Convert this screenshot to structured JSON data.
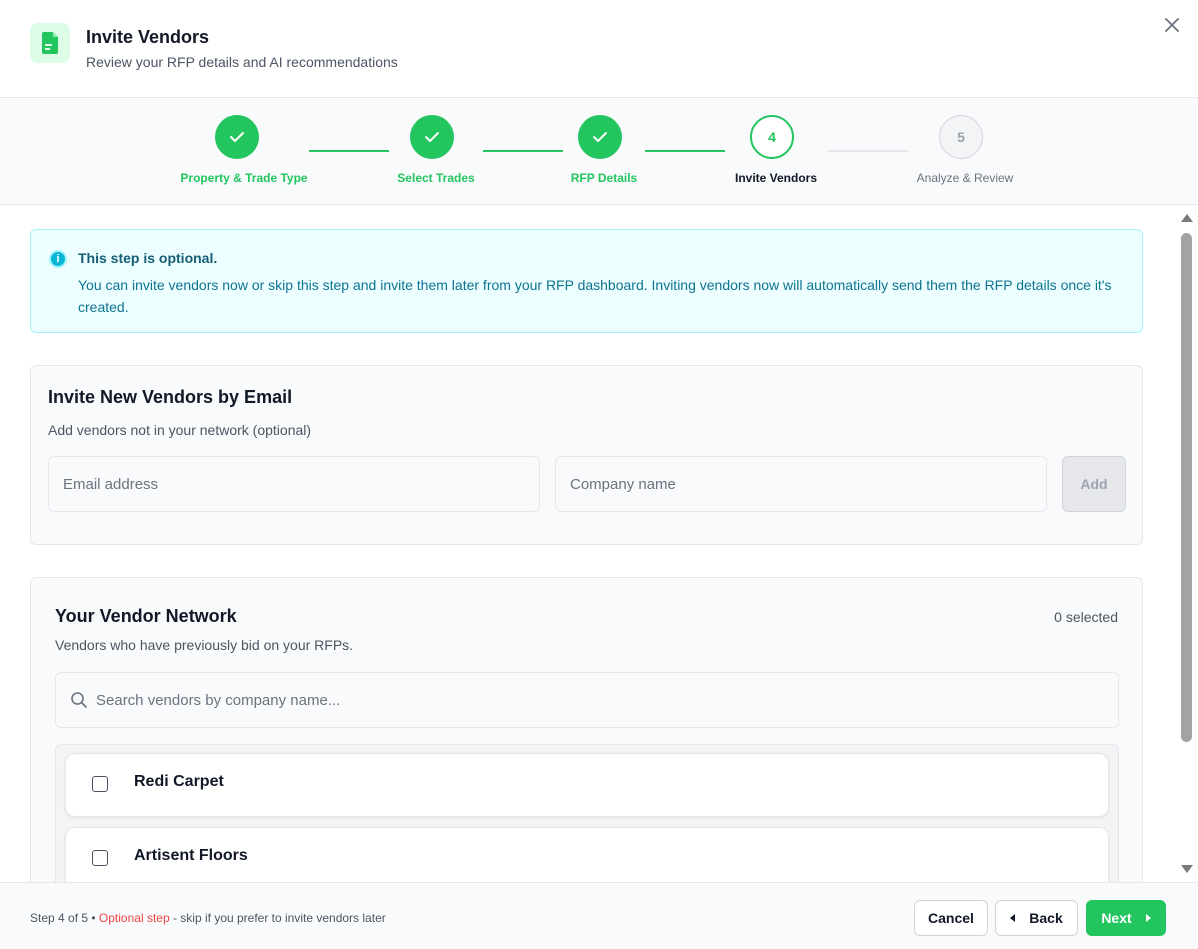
{
  "header": {
    "title": "Invite Vendors",
    "subtitle": "Review your RFP details and AI recommendations",
    "icon": "document-icon",
    "close_icon": "close-icon"
  },
  "stepper": {
    "steps": [
      {
        "number": "1",
        "label": "Property & Trade Type",
        "status": "done"
      },
      {
        "number": "2",
        "label": "Select Trades",
        "status": "done"
      },
      {
        "number": "3",
        "label": "RFP Details",
        "status": "done"
      },
      {
        "number": "4",
        "label": "Invite Vendors",
        "status": "active"
      },
      {
        "number": "5",
        "label": "Analyze & Review",
        "status": "todo"
      }
    ]
  },
  "info": {
    "title": "This step is optional.",
    "text": "You can invite vendors now or skip this step and invite them later from your RFP dashboard. Inviting vendors now will automatically send them the RFP details once it's created.",
    "icon_glyph": "i"
  },
  "invite_new": {
    "title": "Invite New Vendors by Email",
    "subtitle": "Add vendors not in your network (optional)",
    "email_placeholder": "Email address",
    "email_value": "",
    "company_placeholder": "Company name",
    "company_value": "",
    "add_label": "Add"
  },
  "network": {
    "title": "Your Vendor Network",
    "selected_count": "0 selected",
    "subtitle": "Vendors who have previously bid on your RFPs.",
    "search_placeholder": "Search vendors by company name...",
    "search_value": "",
    "vendors": [
      {
        "name": "Redi Carpet",
        "checked": false
      },
      {
        "name": "Artisent Floors",
        "checked": false
      }
    ]
  },
  "footer": {
    "step_text": "Step 4 of 5 • ",
    "optional_text": "Optional step",
    "rest_text": " - skip if you prefer to invite vendors later",
    "cancel_label": "Cancel",
    "back_label": "Back",
    "next_label": "Next"
  },
  "colors": {
    "accent": "#22c55e",
    "info_bg": "#ecfeff",
    "optional": "#ef4444"
  }
}
